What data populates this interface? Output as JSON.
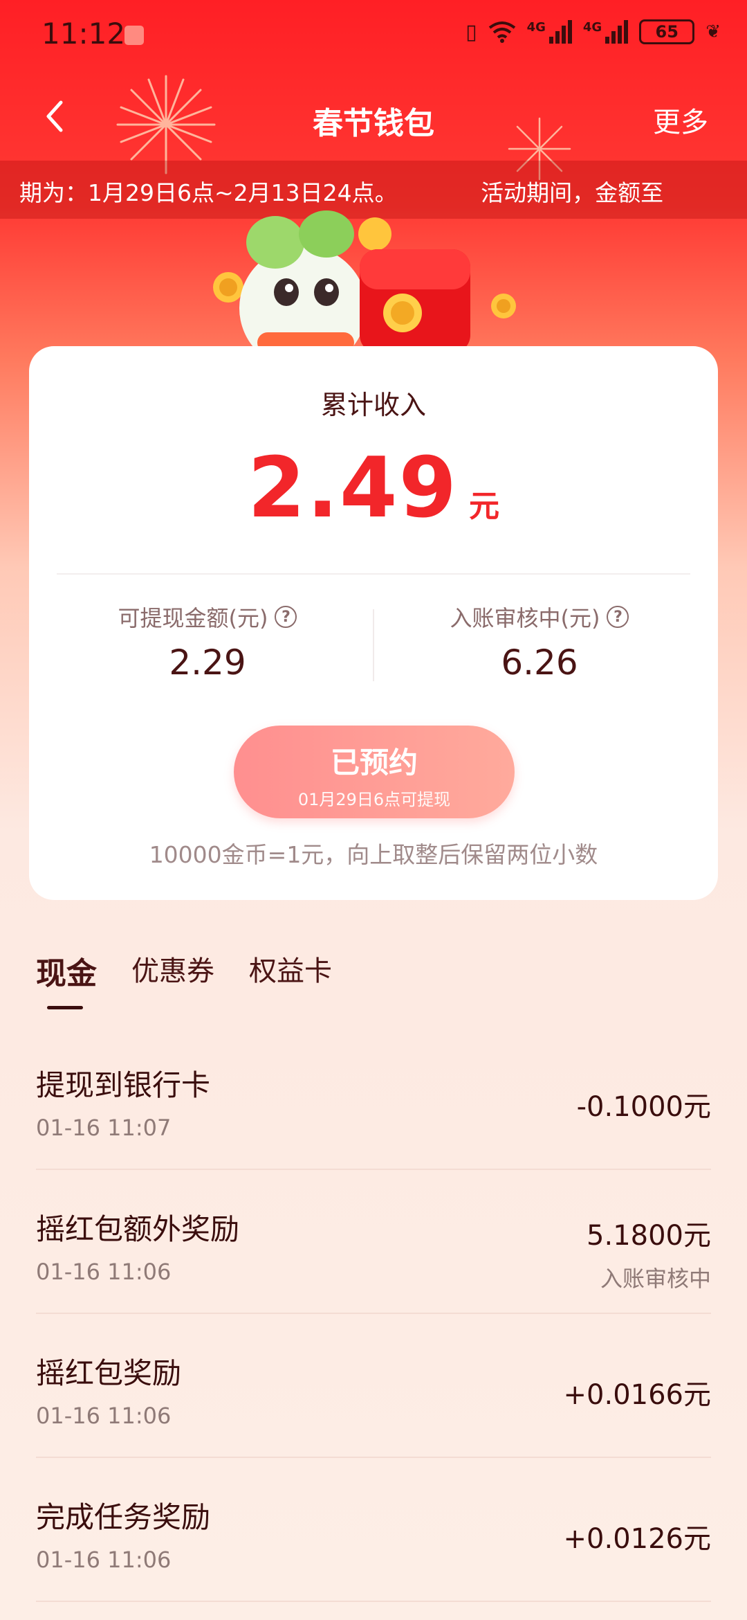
{
  "status_bar": {
    "time": "11:12",
    "net1": "4G",
    "net2": "4G",
    "battery": "65"
  },
  "nav": {
    "title": "春节钱包",
    "more": "更多"
  },
  "marquee": {
    "text1": "期为：1月29日6点~2月13日24点。",
    "text2": "活动期间，金额至"
  },
  "card": {
    "label": "累计收入",
    "total": "2.49",
    "unit": "元",
    "withdrawable_label": "可提现金额(元)",
    "withdrawable_value": "2.29",
    "pending_label": "入账审核中(元)",
    "pending_value": "6.26",
    "button_title": "已预约",
    "button_sub": "01月29日6点可提现",
    "note": "10000金币=1元，向上取整后保留两位小数"
  },
  "tabs": [
    "现金",
    "优惠券",
    "权益卡"
  ],
  "transactions": [
    {
      "title": "提现到银行卡",
      "time": "01-16 11:07",
      "amount": "-0.1000元",
      "status": ""
    },
    {
      "title": "摇红包额外奖励",
      "time": "01-16 11:06",
      "amount": "5.1800元",
      "status": "入账审核中"
    },
    {
      "title": "摇红包奖励",
      "time": "01-16 11:06",
      "amount": "+0.0166元",
      "status": ""
    },
    {
      "title": "完成任务奖励",
      "time": "01-16 11:06",
      "amount": "+0.0126元",
      "status": ""
    }
  ],
  "colors": {
    "primary_red": "#f2262a",
    "header_red": "#ff1f25",
    "text_dark": "#3a0d0d"
  }
}
